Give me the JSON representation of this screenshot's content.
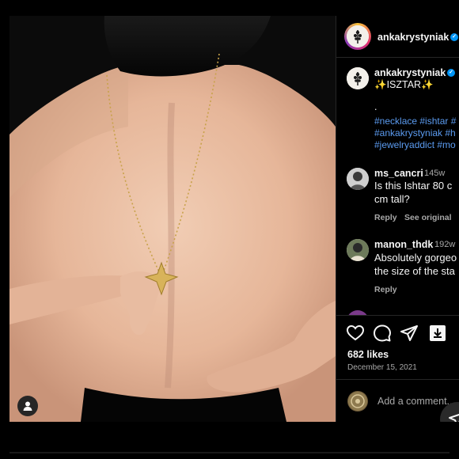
{
  "post": {
    "author": "ankakrystyniak",
    "caption_title": "✨ISZTAR✨",
    "caption_dot": ".",
    "hashtags_line1": "#necklace #ishtar #",
    "hashtags_line2": "#ankakrystyniak #h",
    "hashtags_line3": "#jewelryaddict #mo"
  },
  "comments": [
    {
      "user": "ms_cancri",
      "age": "145w",
      "line1": "Is this Ishtar 80 c",
      "line2": "cm tall?",
      "reply": "Reply",
      "see_original": "See original"
    },
    {
      "user": "manon_thdk",
      "age": "192w",
      "line1": "Absolutely gorgeo",
      "line2": "the size of the sta",
      "reply": "Reply"
    }
  ],
  "actions": {
    "likes": "682 likes",
    "date": "December 15, 2021",
    "comment_placeholder": "Add a comment..."
  },
  "icons": {
    "like": "heart-icon",
    "comment": "comment-bubble-icon",
    "share": "paper-plane-icon",
    "save": "save-download-icon",
    "tag": "person-tag-icon"
  },
  "colors": {
    "background": "#000000",
    "hashtag": "#5b9bf0",
    "verified": "#0095f6",
    "muted": "#a8a8a8"
  }
}
